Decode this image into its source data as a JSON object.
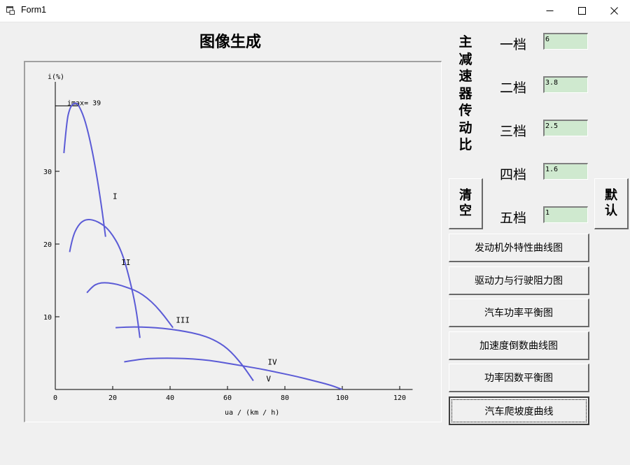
{
  "window": {
    "title": "Form1",
    "icon": "app-window-icon",
    "controls": [
      "minimize-icon",
      "maximize-icon",
      "close-icon"
    ]
  },
  "heading": "图像生成",
  "vertical_label": "主减速器传动比",
  "gears": [
    {
      "label": "一档",
      "value": "6"
    },
    {
      "label": "二档",
      "value": "3.8"
    },
    {
      "label": "三档",
      "value": "2.5"
    },
    {
      "label": "四档",
      "value": "1.6"
    },
    {
      "label": "五档",
      "value": "1"
    }
  ],
  "buttons": {
    "clear": "清空",
    "default": "默认",
    "actions": [
      "发动机外特性曲线图",
      "驱动力与行驶阻力图",
      "汽车功率平衡图",
      "加速度倒数曲线图",
      "功率因数平衡图",
      "汽车爬坡度曲线"
    ]
  },
  "chart_data": {
    "type": "line",
    "title": "",
    "xlabel": "ua / (km / h)",
    "ylabel": "i(%)",
    "xlim": [
      0,
      120
    ],
    "ylim": [
      0,
      40
    ],
    "xticks": [
      0,
      20,
      40,
      60,
      80,
      100,
      120
    ],
    "yticks": [
      10,
      20,
      30
    ],
    "grid": false,
    "legend": "none",
    "line_color": "#5b5bd6",
    "annotation": {
      "text": "imax= 39",
      "value": 39
    },
    "series": [
      {
        "name": "I",
        "x": [
          3,
          4,
          5,
          6,
          7,
          8,
          10,
          12,
          14,
          16,
          17.5
        ],
        "y": [
          32.5,
          37,
          38.6,
          39.2,
          39.4,
          39.2,
          37.5,
          34.5,
          30.5,
          25.5,
          21
        ]
      },
      {
        "name": "II",
        "x": [
          5,
          6,
          8,
          10,
          12,
          14,
          16,
          18,
          20,
          22,
          24,
          26,
          28,
          29.5
        ],
        "y": [
          18.9,
          21,
          22.6,
          23.3,
          23.4,
          23.2,
          22.8,
          22.2,
          21.2,
          19.9,
          17.9,
          15,
          11.5,
          7.1
        ]
      },
      {
        "name": "III",
        "x": [
          11,
          13,
          15,
          17,
          20,
          23,
          26,
          29,
          32,
          35,
          38,
          41
        ],
        "y": [
          13.3,
          14.2,
          14.6,
          14.7,
          14.6,
          14.3,
          13.9,
          13.4,
          12.6,
          11.5,
          10.1,
          8.5
        ]
      },
      {
        "name": "IV",
        "x": [
          21,
          25,
          30,
          35,
          40,
          45,
          50,
          55,
          60,
          65,
          69
        ],
        "y": [
          8.5,
          8.6,
          8.6,
          8.5,
          8.3,
          8,
          7.6,
          6.9,
          5.7,
          3.5,
          1.2
        ]
      },
      {
        "name": "V",
        "x": [
          24,
          30,
          36,
          42,
          48,
          54,
          60,
          66,
          72,
          78,
          84,
          90,
          96,
          100
        ],
        "y": [
          3.8,
          4.2,
          4.3,
          4.3,
          4.2,
          4,
          3.6,
          3.2,
          2.8,
          2.3,
          1.8,
          1.2,
          0.6,
          0
        ]
      }
    ],
    "series_labels": [
      {
        "text": "I",
        "x": 20,
        "y": 26.2
      },
      {
        "text": "II",
        "x": 23,
        "y": 17.1
      },
      {
        "text": "III",
        "x": 42,
        "y": 9.2
      },
      {
        "text": "IV",
        "x": 74,
        "y": 3.4
      },
      {
        "text": "V",
        "x": 73.5,
        "y": 1.1
      }
    ]
  }
}
